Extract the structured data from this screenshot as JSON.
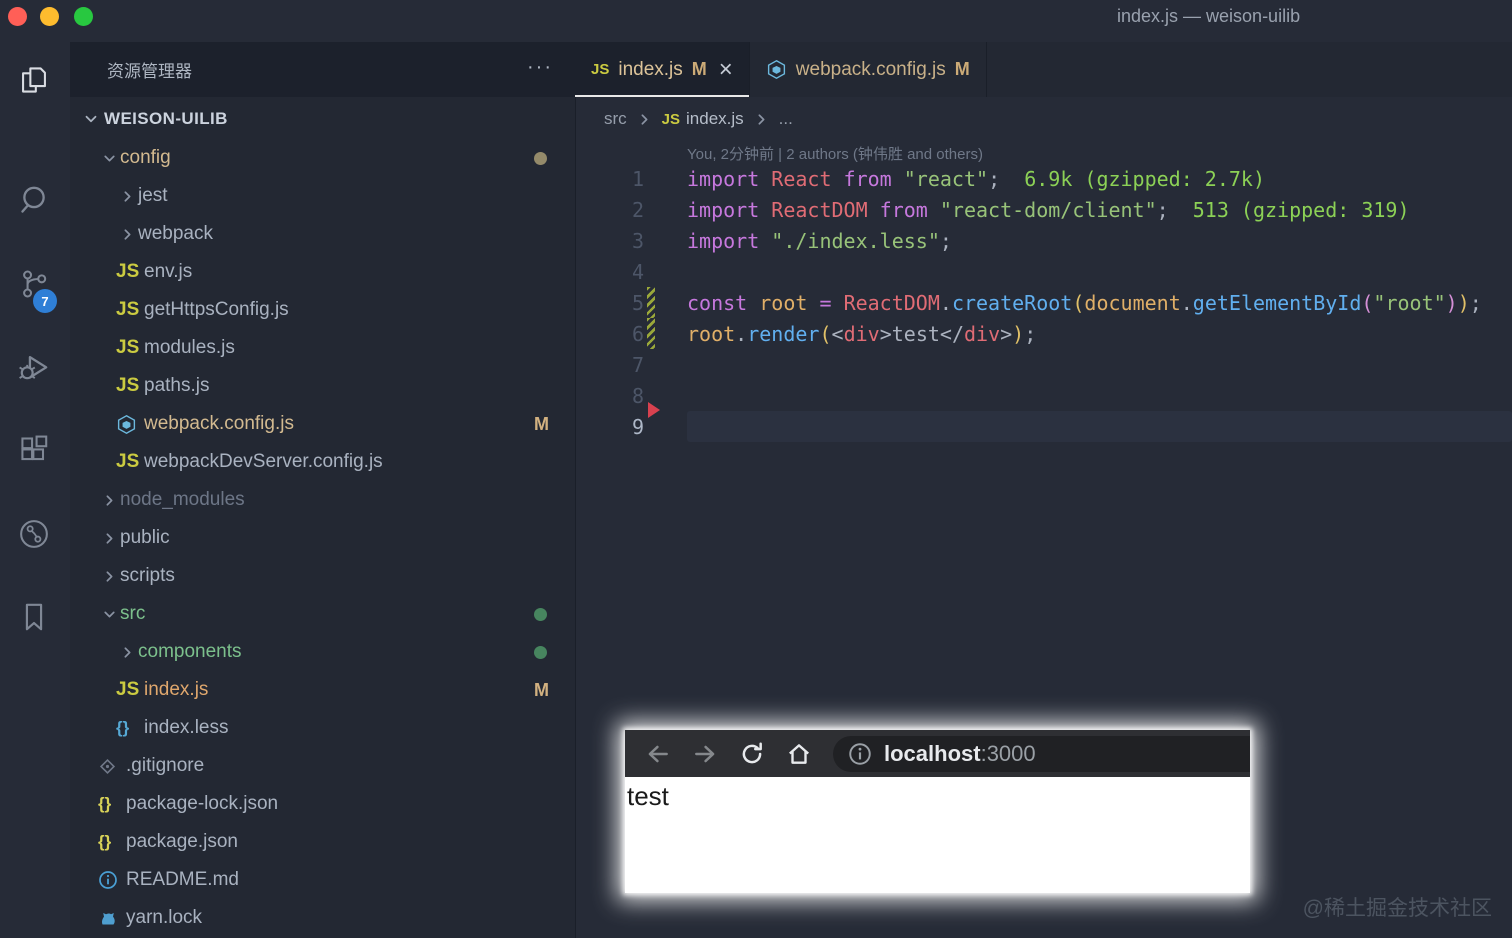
{
  "window": {
    "title": "index.js — weison-uilib"
  },
  "activity_bar": {
    "badge": "7",
    "icons": [
      "files",
      "search",
      "source-control",
      "run-debug",
      "extensions",
      "gitlens",
      "bookmarks"
    ]
  },
  "sidebar": {
    "header": "资源管理器",
    "header_actions": "···",
    "section": "WEISON-UILIB",
    "tree": [
      {
        "label": "config",
        "depth": 1,
        "twisty": "down",
        "icon": null,
        "color": "gold",
        "dot": "gold"
      },
      {
        "label": "jest",
        "depth": 2,
        "twisty": "right",
        "icon": null
      },
      {
        "label": "webpack",
        "depth": 2,
        "twisty": "right",
        "icon": null
      },
      {
        "label": "env.js",
        "depth": 2,
        "twisty": null,
        "icon": "js"
      },
      {
        "label": "getHttpsConfig.js",
        "depth": 2,
        "twisty": null,
        "icon": "js"
      },
      {
        "label": "modules.js",
        "depth": 2,
        "twisty": null,
        "icon": "js"
      },
      {
        "label": "paths.js",
        "depth": 2,
        "twisty": null,
        "icon": "js"
      },
      {
        "label": "webpack.config.js",
        "depth": 2,
        "twisty": null,
        "icon": "webpack",
        "color": "gold",
        "badge": "M"
      },
      {
        "label": "webpackDevServer.config.js",
        "depth": 2,
        "twisty": null,
        "icon": "js"
      },
      {
        "label": "node_modules",
        "depth": 1,
        "twisty": "right",
        "icon": null,
        "color": "dim"
      },
      {
        "label": "public",
        "depth": 1,
        "twisty": "right",
        "icon": null
      },
      {
        "label": "scripts",
        "depth": 1,
        "twisty": "right",
        "icon": null
      },
      {
        "label": "src",
        "depth": 1,
        "twisty": "down",
        "icon": null,
        "color": "green",
        "dot": "green"
      },
      {
        "label": "components",
        "depth": 2,
        "twisty": "right",
        "icon": null,
        "color": "green",
        "dot": "green"
      },
      {
        "label": "index.js",
        "depth": 2,
        "twisty": null,
        "icon": "js",
        "color": "orange",
        "badge": "M"
      },
      {
        "label": "index.less",
        "depth": 2,
        "twisty": null,
        "icon": "braces-blue"
      },
      {
        "label": ".gitignore",
        "depth": 1,
        "twisty": null,
        "icon": "git"
      },
      {
        "label": "package-lock.json",
        "depth": 1,
        "twisty": null,
        "icon": "braces-yellow"
      },
      {
        "label": "package.json",
        "depth": 1,
        "twisty": null,
        "icon": "braces-yellow"
      },
      {
        "label": "README.md",
        "depth": 1,
        "twisty": null,
        "icon": "info"
      },
      {
        "label": "yarn.lock",
        "depth": 1,
        "twisty": null,
        "icon": "yarn"
      }
    ]
  },
  "tabs": [
    {
      "label": "index.js",
      "badge": "M",
      "icon": "js",
      "active": true,
      "closable": true
    },
    {
      "label": "webpack.config.js",
      "badge": "M",
      "icon": "webpack",
      "active": false,
      "closable": false
    }
  ],
  "breadcrumb": [
    {
      "label": "src"
    },
    {
      "label": "index.js",
      "icon": "js"
    },
    {
      "label": "..."
    }
  ],
  "editor": {
    "codelens": "You, 2分钟前 | 2 authors (钟伟胜 and others)",
    "lines": [
      {
        "n": 1,
        "tokens": [
          {
            "c": "kw",
            "t": "import "
          },
          {
            "c": "var",
            "t": "React "
          },
          {
            "c": "kw",
            "t": "from "
          },
          {
            "c": "str",
            "t": "\"react\""
          },
          {
            "c": "pun",
            "t": ";"
          },
          {
            "c": "cost",
            "t": "  6.9k (gzipped: 2.7k)"
          }
        ]
      },
      {
        "n": 2,
        "tokens": [
          {
            "c": "kw",
            "t": "import "
          },
          {
            "c": "var",
            "t": "ReactDOM "
          },
          {
            "c": "kw",
            "t": "from "
          },
          {
            "c": "str",
            "t": "\"react-dom/client\""
          },
          {
            "c": "pun",
            "t": ";"
          },
          {
            "c": "cost",
            "t": "  513 (gzipped: 319)"
          }
        ]
      },
      {
        "n": 3,
        "tokens": [
          {
            "c": "kw",
            "t": "import "
          },
          {
            "c": "str",
            "t": "\"./index.less\""
          },
          {
            "c": "pun",
            "t": ";"
          }
        ]
      },
      {
        "n": 4,
        "tokens": []
      },
      {
        "n": 5,
        "modified": true,
        "tokens": [
          {
            "c": "kw",
            "t": "const "
          },
          {
            "c": "orn",
            "t": "root "
          },
          {
            "c": "kw",
            "t": "= "
          },
          {
            "c": "var",
            "t": "ReactDOM"
          },
          {
            "c": "pun",
            "t": "."
          },
          {
            "c": "fn",
            "t": "createRoot"
          },
          {
            "c": "b1",
            "t": "("
          },
          {
            "c": "orn",
            "t": "document"
          },
          {
            "c": "pun",
            "t": "."
          },
          {
            "c": "fn",
            "t": "getElementById"
          },
          {
            "c": "b2",
            "t": "("
          },
          {
            "c": "str",
            "t": "\"root\""
          },
          {
            "c": "b2",
            "t": ")"
          },
          {
            "c": "b1",
            "t": ")"
          },
          {
            "c": "pun",
            "t": ";"
          }
        ]
      },
      {
        "n": 6,
        "modified": true,
        "tokens": [
          {
            "c": "orn",
            "t": "root"
          },
          {
            "c": "pun",
            "t": "."
          },
          {
            "c": "fn",
            "t": "render"
          },
          {
            "c": "b1",
            "t": "("
          },
          {
            "c": "pun",
            "t": "<"
          },
          {
            "c": "tag",
            "t": "div"
          },
          {
            "c": "pun",
            "t": ">"
          },
          {
            "c": "pln",
            "t": "test"
          },
          {
            "c": "pun",
            "t": "</"
          },
          {
            "c": "tag",
            "t": "div"
          },
          {
            "c": "pun",
            "t": ">"
          },
          {
            "c": "b1",
            "t": ")"
          },
          {
            "c": "pun",
            "t": ";"
          }
        ]
      },
      {
        "n": 7,
        "tokens": []
      },
      {
        "n": 8,
        "tokens": []
      },
      {
        "n": 9,
        "tokens": [],
        "current": true,
        "arrow": true
      }
    ]
  },
  "browser_overlay": {
    "host": "localhost",
    "port": ":3000",
    "page_text": "test"
  },
  "watermark": "@稀土掘金技术社区"
}
